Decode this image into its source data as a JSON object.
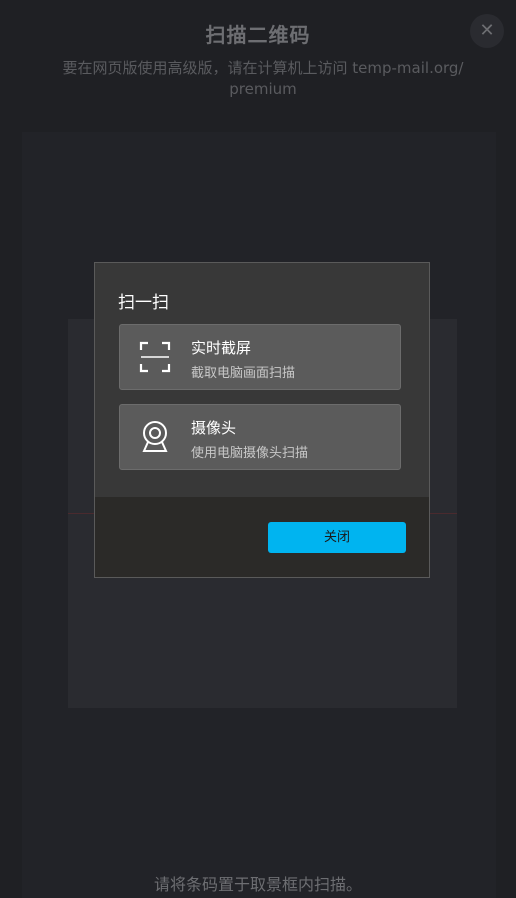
{
  "page": {
    "title": "扫描二维码",
    "subtitle": "要在网页版使用高级版，请在计算机上访问 temp-mail.org/ premium",
    "hint": "请将条码置于取景框内扫描。",
    "close_glyph": "✕"
  },
  "dialog": {
    "title": "扫一扫",
    "options": [
      {
        "name": "实时截屏",
        "desc": "截取电脑画面扫描",
        "icon": "screen-capture-icon"
      },
      {
        "name": "摄像头",
        "desc": "使用电脑摄像头扫描",
        "icon": "camera-icon"
      }
    ],
    "close_label": "关闭"
  },
  "colors": {
    "accent": "#00b4f0",
    "dialog_bg": "#383838",
    "option_bg": "#5b5b5b"
  }
}
